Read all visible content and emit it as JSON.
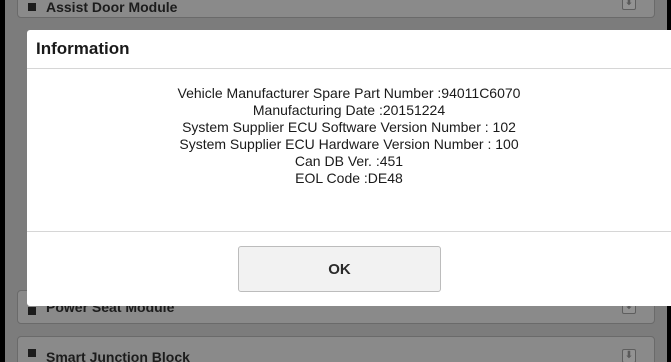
{
  "background_modules": {
    "top": "Assist Door Module",
    "middle": "Power Seat Module",
    "bottom": "Smart Junction Block"
  },
  "dialog": {
    "title": "Information",
    "lines": [
      "Vehicle Manufacturer Spare Part Number :94011C6070",
      "Manufacturing Date :20151224",
      "System Supplier ECU Software Version Number : 102",
      "System Supplier ECU Hardware Version Number : 100",
      "Can DB Ver. :451",
      "EOL Code :DE48"
    ],
    "ok_label": "OK"
  },
  "icons": {
    "module_bullet": "square-bullet-icon",
    "download": "download-icon"
  },
  "colors": {
    "overlay_bg": "#7c7c7c",
    "dialog_bg": "#ffffff",
    "button_bg": "#f2f2f2"
  }
}
